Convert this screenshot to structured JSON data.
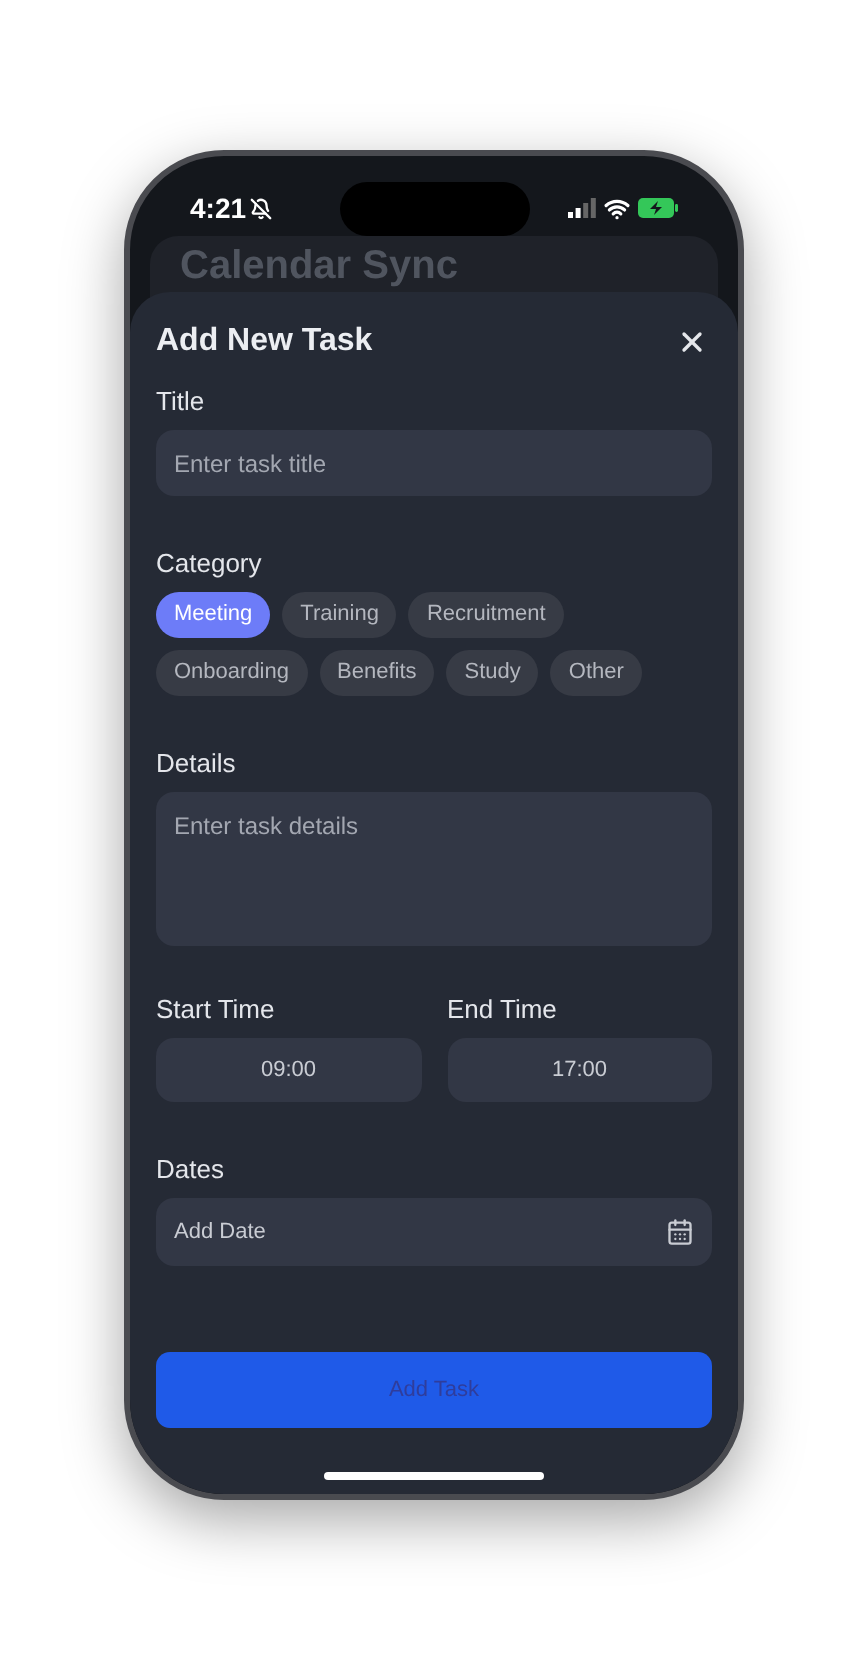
{
  "status_bar": {
    "time": "4:21"
  },
  "background_card": {
    "title": "Calendar Sync"
  },
  "sheet": {
    "title": "Add New Task",
    "title_field": {
      "label": "Title",
      "placeholder": "Enter task title"
    },
    "category": {
      "label": "Category",
      "options": [
        {
          "label": "Meeting",
          "selected": true
        },
        {
          "label": "Training",
          "selected": false
        },
        {
          "label": "Recruitment",
          "selected": false
        },
        {
          "label": "Onboarding",
          "selected": false
        },
        {
          "label": "Benefits",
          "selected": false
        },
        {
          "label": "Study",
          "selected": false
        },
        {
          "label": "Other",
          "selected": false
        }
      ]
    },
    "details_field": {
      "label": "Details",
      "placeholder": "Enter task details"
    },
    "start_time": {
      "label": "Start Time",
      "value": "09:00"
    },
    "end_time": {
      "label": "End Time",
      "value": "17:00"
    },
    "dates": {
      "label": "Dates",
      "placeholder": "Add Date"
    },
    "submit": {
      "label": "Add Task",
      "disabled": true
    }
  }
}
